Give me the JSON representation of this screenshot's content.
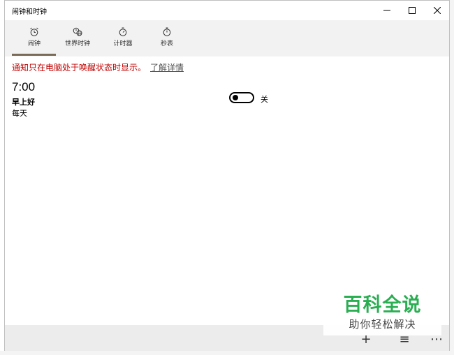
{
  "window": {
    "title": "闹钟和时钟"
  },
  "tabs": [
    {
      "label": "闹钟",
      "icon": "alarm-clock-icon",
      "active": true
    },
    {
      "label": "世界时钟",
      "icon": "world-clock-icon",
      "active": false
    },
    {
      "label": "计时器",
      "icon": "timer-icon",
      "active": false
    },
    {
      "label": "秒表",
      "icon": "stopwatch-icon",
      "active": false
    }
  ],
  "notice": {
    "text": "通知只在电脑处于唤醒状态时显示。",
    "link": "了解详情",
    "color": "#c00000"
  },
  "alarm": {
    "time": "7:00",
    "name": "早上好",
    "repeat": "每天",
    "toggle_state": "关",
    "enabled": false
  },
  "watermark": {
    "main": "百科全说",
    "sub": "助你轻松解决",
    "color": "#2aae52"
  },
  "colors": {
    "accent": "#7a6a58",
    "tabbar_bg": "#f2f2f2",
    "bottom_bar_bg": "#ececec"
  }
}
